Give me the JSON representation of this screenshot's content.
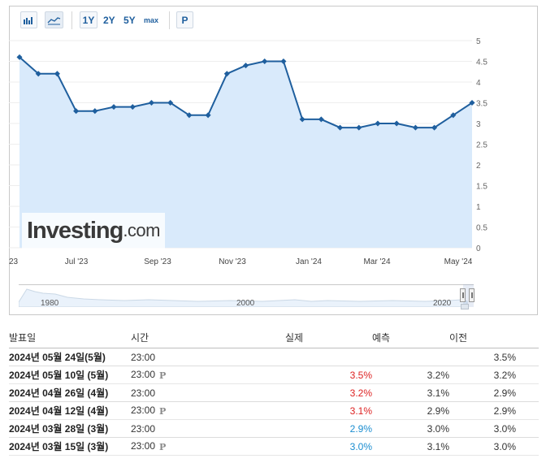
{
  "toolbar": {
    "ranges": [
      "1Y",
      "2Y",
      "5Y",
      "max"
    ],
    "active_range": "1Y",
    "p_label": "P",
    "icons": [
      "bar-chart-icon",
      "area-chart-icon"
    ]
  },
  "chart_data": {
    "type": "area",
    "x": [
      "2023-05",
      "2023-06a",
      "2023-06b",
      "2023-07a",
      "2023-07b",
      "2023-08a",
      "2023-08b",
      "2023-09a",
      "2023-09b",
      "2023-10a",
      "2023-10b",
      "2023-11a",
      "2023-11b",
      "2023-12a",
      "2023-12b",
      "2024-01a",
      "2024-01b",
      "2024-02a",
      "2024-02b",
      "2024-03a",
      "2024-03b",
      "2024-04a",
      "2024-04b",
      "2024-05a",
      "2024-05b"
    ],
    "values": [
      4.6,
      4.2,
      4.2,
      3.3,
      3.3,
      3.4,
      3.4,
      3.5,
      3.5,
      3.2,
      3.2,
      4.2,
      4.4,
      4.5,
      4.5,
      3.1,
      3.1,
      2.9,
      2.9,
      3.0,
      3.0,
      2.9,
      2.9,
      3.2,
      3.5
    ],
    "ylim": [
      0,
      5
    ],
    "yticks": [
      "5",
      "4.5",
      "4",
      "3.5",
      "3",
      "2.5",
      "2",
      "1.5",
      "1",
      "0.5",
      "0"
    ],
    "xtick_labels": [
      "23",
      "Jul '23",
      "Sep '23",
      "Nov '23",
      "Jan '24",
      "Mar '24",
      "May '24"
    ],
    "grid": true,
    "line_color": "#1f5f9e",
    "fill_color": "#d7e9fb"
  },
  "watermark": {
    "main": "Investing",
    "domain": ".com"
  },
  "navigator": {
    "years": [
      "1980",
      "2000",
      "2020"
    ]
  },
  "table": {
    "headers": {
      "date": "발표일",
      "time": "시간",
      "actual": "실제",
      "forecast": "예측",
      "previous": "이전"
    },
    "rows": [
      {
        "date": "2024년 05월 24일(5월)",
        "time": "23:00",
        "prelim": false,
        "actual": "",
        "actual_status": "",
        "forecast": "",
        "previous": "3.5%"
      },
      {
        "date": "2024년 05월 10일 (5월)",
        "time": "23:00",
        "prelim": true,
        "actual": "3.5%",
        "actual_status": "neg",
        "forecast": "3.2%",
        "previous": "3.2%"
      },
      {
        "date": "2024년 04월 26일 (4월)",
        "time": "23:00",
        "prelim": false,
        "actual": "3.2%",
        "actual_status": "neg",
        "forecast": "3.1%",
        "previous": "2.9%"
      },
      {
        "date": "2024년 04월 12일 (4월)",
        "time": "23:00",
        "prelim": true,
        "actual": "3.1%",
        "actual_status": "neg",
        "forecast": "2.9%",
        "previous": "2.9%"
      },
      {
        "date": "2024년 03월 28일 (3월)",
        "time": "23:00",
        "prelim": false,
        "actual": "2.9%",
        "actual_status": "pos",
        "forecast": "3.0%",
        "previous": "3.0%"
      },
      {
        "date": "2024년 03월 15일 (3월)",
        "time": "23:00",
        "prelim": true,
        "actual": "3.0%",
        "actual_status": "pos",
        "forecast": "3.1%",
        "previous": "3.0%"
      }
    ],
    "prelim_glyph": "P",
    "colors": {
      "neg": "#dd2222",
      "pos": "#1a8dd0"
    }
  }
}
